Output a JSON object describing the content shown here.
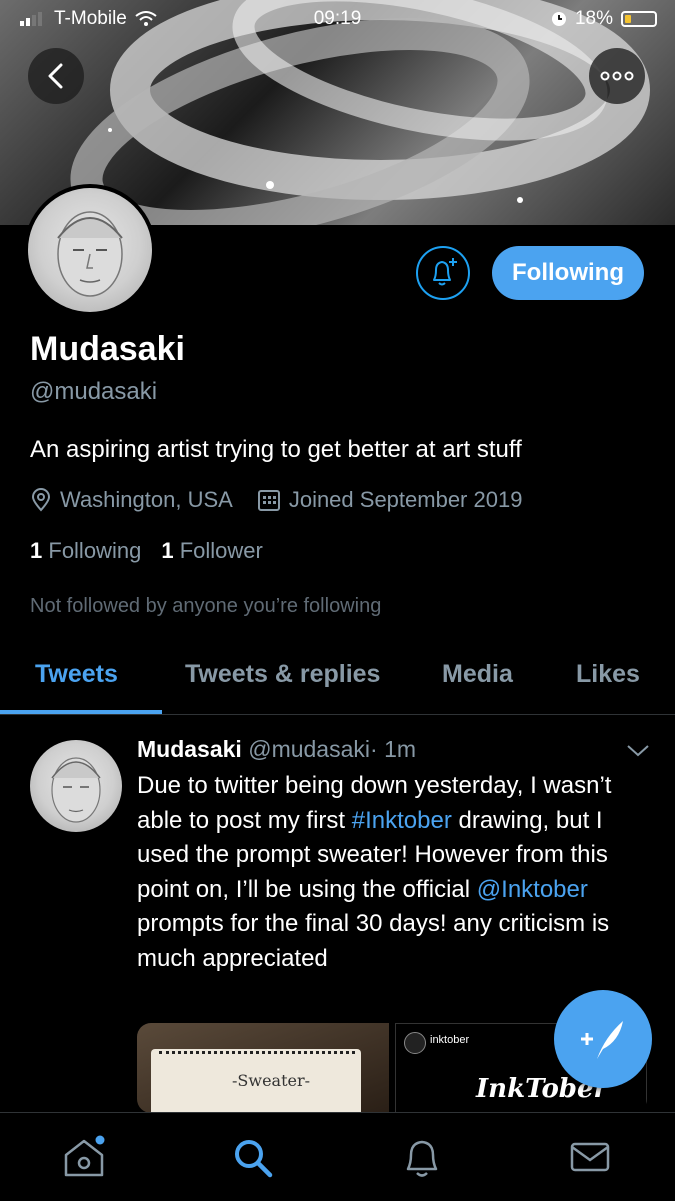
{
  "status_bar": {
    "carrier": "T-Mobile",
    "time": "09:19",
    "battery": "18%"
  },
  "profile": {
    "name": "Mudasaki",
    "handle": "@mudasaki",
    "bio": "An aspiring artist trying to get better at art stuff",
    "location": "Washington, USA",
    "joined": "Joined September 2019",
    "following_count": "1",
    "following_label": "Following",
    "followers_count": "1",
    "followers_label": "Follower",
    "not_followed": "Not followed by anyone you’re following",
    "follow_button": "Following"
  },
  "tabs": [
    {
      "label": "Tweets"
    },
    {
      "label": "Tweets & replies"
    },
    {
      "label": "Media"
    },
    {
      "label": "Likes"
    }
  ],
  "tweet": {
    "name": "Mudasaki",
    "handle": "@mudasaki",
    "time": "· 1m",
    "text_1": "Due to twitter being down yesterday, I wasn’t able to post my first ",
    "hashtag": "#Inktober",
    "text_2": " drawing, but I used the prompt sweater! However from this point on, I’ll be using the official ",
    "mention": "@Inktober",
    "text_3": " prompts for the final 30 days! any criticism is much appreciated",
    "media": {
      "image1_caption": "-Sweater-",
      "image2_account": "inktober",
      "image2_title": "InkTober"
    }
  },
  "colors": {
    "accent": "#4ba3f0",
    "secondary_text": "#8899a6",
    "background": "#000000"
  },
  "icons": [
    "back-arrow-icon",
    "more-icon",
    "bell-plus-icon",
    "location-pin-icon",
    "calendar-icon",
    "chevron-down-icon",
    "compose-tweet-icon",
    "home-icon",
    "search-icon",
    "notifications-icon",
    "messages-icon"
  ]
}
